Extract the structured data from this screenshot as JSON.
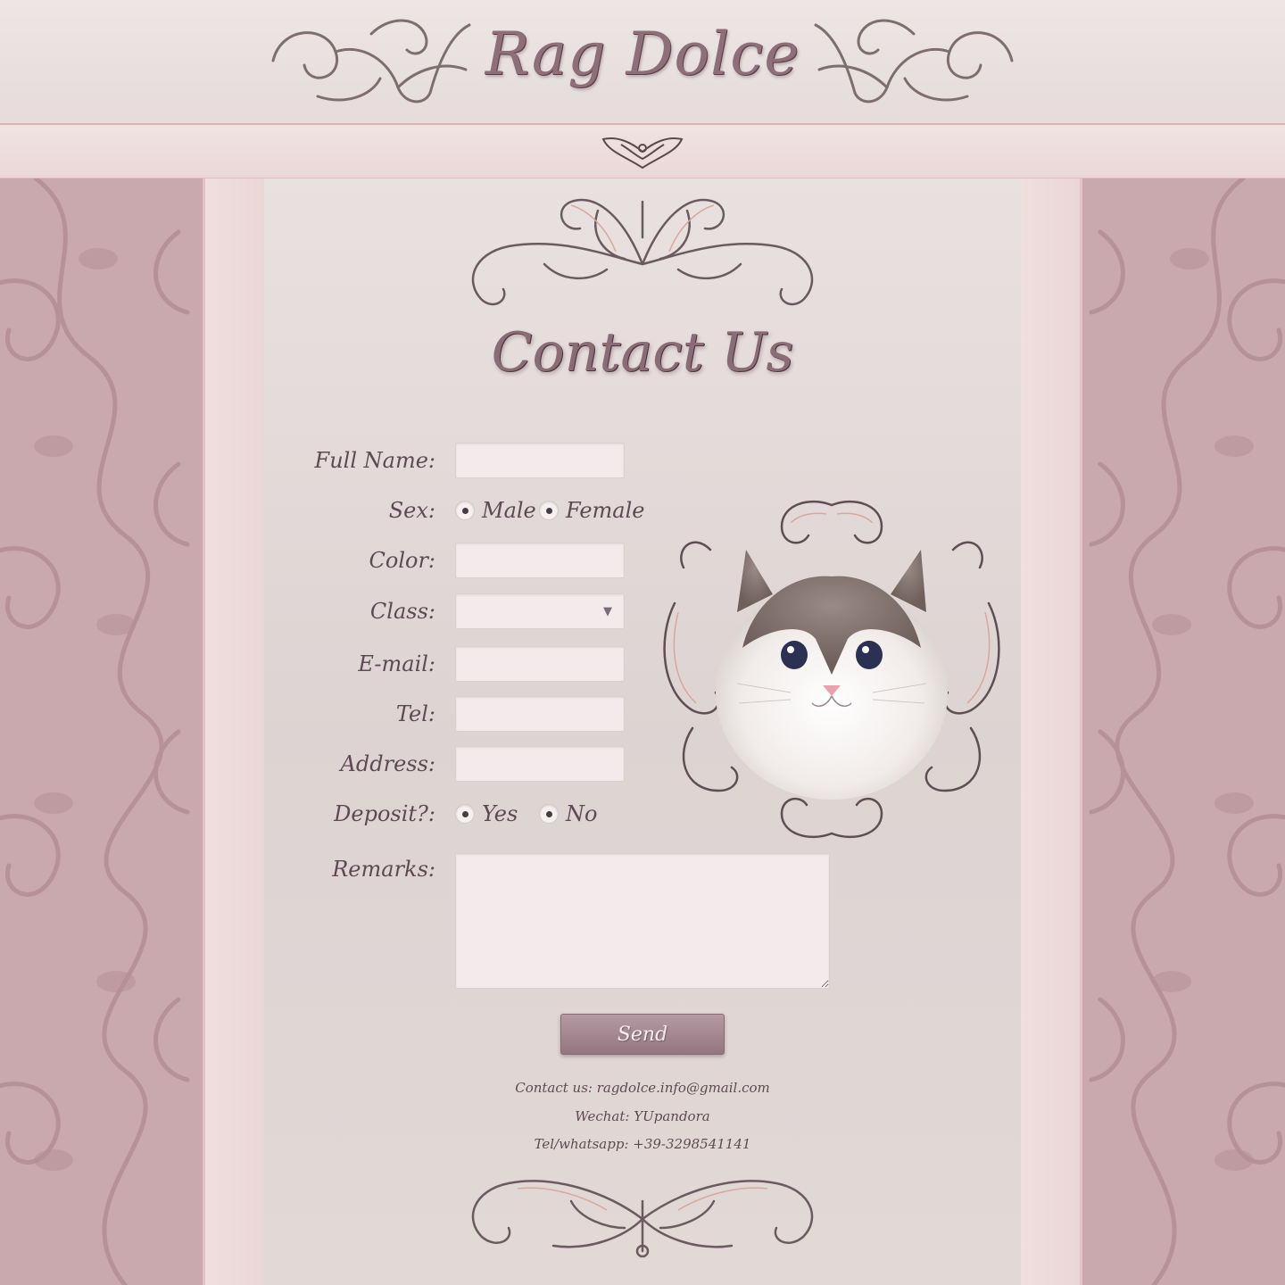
{
  "header": {
    "logo": "Rag Dolce"
  },
  "page": {
    "title": "Contact Us"
  },
  "form": {
    "full_name": {
      "label": "Full Name:",
      "value": ""
    },
    "sex": {
      "label": "Sex:",
      "options": [
        "Male",
        "Female"
      ]
    },
    "color": {
      "label": "Color:",
      "value": ""
    },
    "class": {
      "label": "Class:",
      "value": ""
    },
    "email": {
      "label": "E-mail:",
      "value": ""
    },
    "tel": {
      "label": "Tel:",
      "value": ""
    },
    "address": {
      "label": "Address:",
      "value": ""
    },
    "deposit": {
      "label": "Deposit?:",
      "options": [
        "Yes",
        "No"
      ]
    },
    "remarks": {
      "label": "Remarks:",
      "value": ""
    },
    "send_label": "Send"
  },
  "contact": {
    "email_line": "Contact us:  ragdolce.info@gmail.com",
    "wechat_line": "Wechat: YUpandora",
    "tel_line": "Tel/whatsapp: +39-3298541141"
  },
  "colors": {
    "accent": "#927780",
    "side_panel": "#c9a9ad",
    "text": "#5e4a54"
  },
  "icons": {
    "select_caret": "caret-down-icon",
    "ornament": "baroque-scroll-ornament"
  }
}
